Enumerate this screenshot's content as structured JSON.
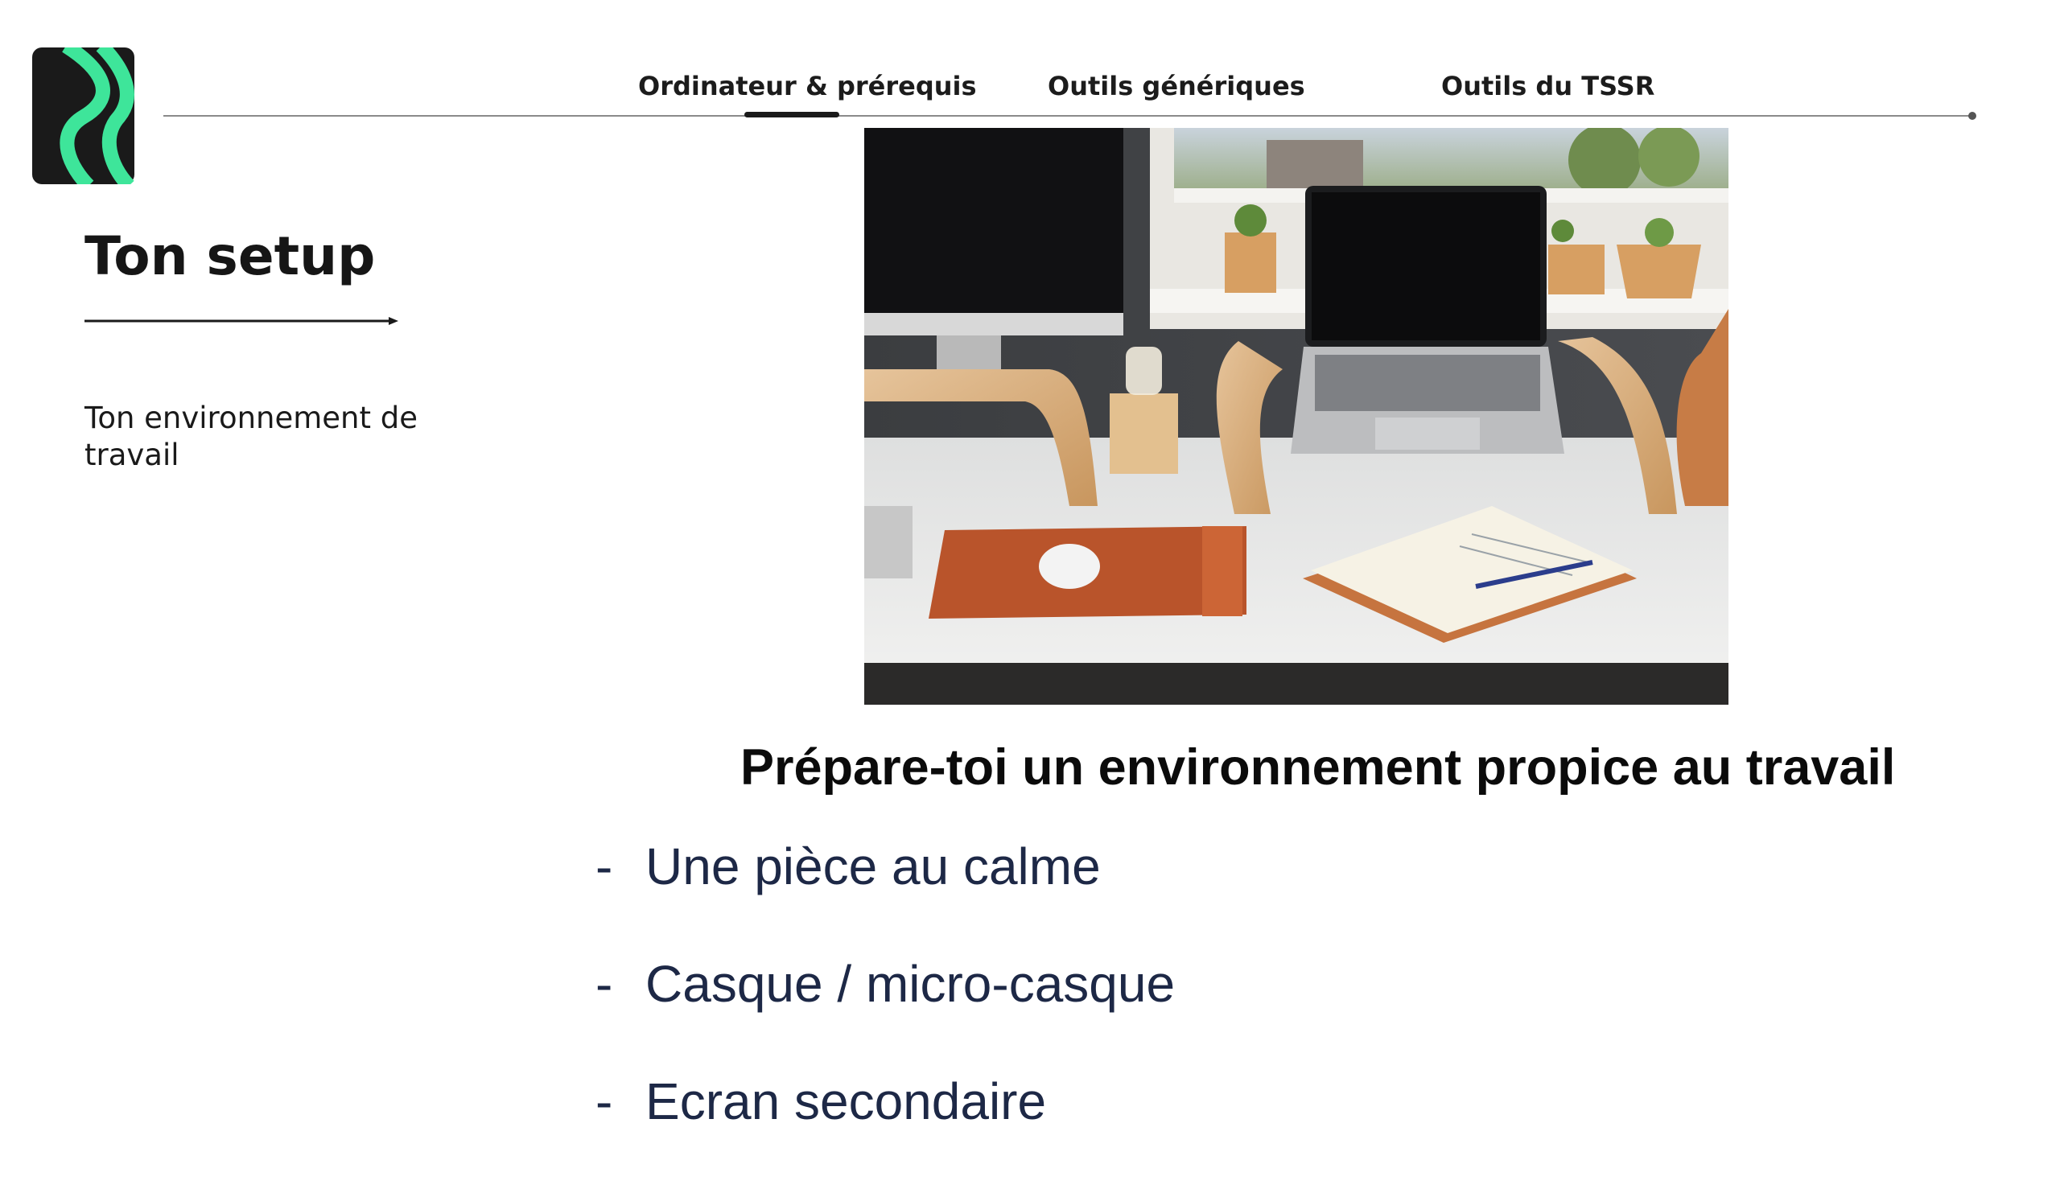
{
  "nav": {
    "tabs": [
      {
        "label": "Ordinateur & prérequis",
        "active": true
      },
      {
        "label": "Outils génériques",
        "active": false
      },
      {
        "label": "Outils du TSSR",
        "active": false
      }
    ]
  },
  "section": {
    "title": "Ton setup",
    "subtitle": "Ton environnement de travail"
  },
  "photo": {
    "alt": "desk-setup-photo"
  },
  "content": {
    "heading": "Prépare-toi un environnement propice au travail",
    "bullet_marker": "-",
    "bullets": [
      "Une pièce au calme",
      "Casque / micro-casque",
      "Ecran secondaire"
    ]
  },
  "colors": {
    "accent": "#3ee59a",
    "logo_bg": "#1a1a1a",
    "bullet_text": "#1d2846"
  },
  "icons": {
    "logo": "chevron-logo-icon",
    "arrow": "arrow-right-icon"
  }
}
